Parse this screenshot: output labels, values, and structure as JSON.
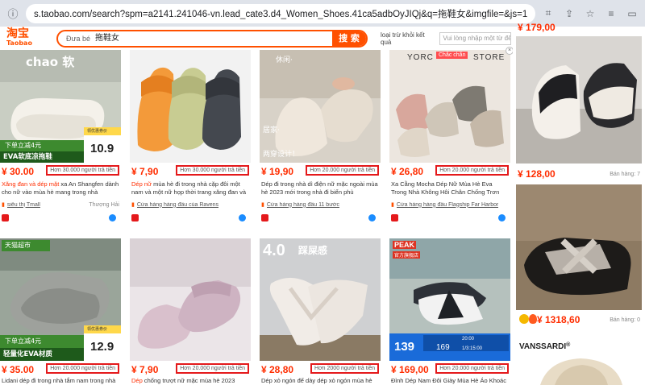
{
  "browser": {
    "url": "s.taobao.com/search?spm=a2141.241046-vn.lead_cate3.d4_Women_Shoes.41ca5adbOyJIQj&q=拖鞋女&imgfile=&js=1&stats_click=s..."
  },
  "header": {
    "logo_cn": "淘宝",
    "logo_en": "Taobao",
    "search_scope": "Đưa bé",
    "search_query": "拖鞋女",
    "search_button": "搜 索",
    "exclude_label": "loại trừ khỏi kết quả",
    "exclude_placeholder": "Vui lòng nhập một từ để"
  },
  "products": [
    {
      "img_tag": "chao 软",
      "badge_top": "下单立减4元",
      "badge_main": "EVA软底凉拖鞋",
      "badge_price_label": "领优惠券价",
      "badge_price": "10.9",
      "price": "¥ 30.00",
      "paid": "Hơn 30.000 người trả tiền",
      "title_hl": "Xăng đan và dép mặt",
      "title_rest": " xa An Shangfen dành cho nữ vào mùa hè mang trong nhà",
      "shop": "siêu thị Tmall",
      "location": "Thượng Hải"
    },
    {
      "price": "¥ 7,90",
      "paid": "Hơn 30.000 người trả tiền",
      "title_hl": "Dép nữ",
      "title_rest": " mùa hè đi trong nhà cặp đôi một nam và một nữ họp thời trang xăng đan và",
      "shop": "Cửa hàng hàng đầu của Ravens",
      "location": ""
    },
    {
      "img_tag": "休闲·",
      "img_tag2": "居家·",
      "img_tag3": "两穿设计！",
      "price": "¥ 19,90",
      "paid": "Hơn 20.000 người trả tiền",
      "title_hl": "",
      "title_rest": "Dép đi trong nhà dì điện nữ mặc ngoài mùa hè 2023 mới trong nhà đi biển phù",
      "shop": "Cửa hàng hàng đầu 11 bước",
      "location": ""
    },
    {
      "img_tag": "YORC",
      "img_tag2": "STORE",
      "img_badge": "Chắc chắn",
      "price": "¥ 26,80",
      "paid": "Hơn 20.000 người trả tiền",
      "title_hl": "",
      "title_rest": "Xa Cằng Mocha Dép Nữ Mùa Hè Eva Trong Nhà Không Hôi Chân Chống Trơn",
      "shop": "Cửa hàng hàng đầu Flagship Far Harbor",
      "location": ""
    },
    {
      "img_tag": "天猫超市",
      "badge_top": "下单立减4元",
      "badge_main": "轻量化EVA材质",
      "badge_price_label": "领优惠券价",
      "badge_price": "12.9",
      "price": "¥ 35.00",
      "paid": "Hơn 20.000 người trả tiền",
      "title_hl": "",
      "title_rest": "Lidani dép đi trong nhà tắm nam trong nhà",
      "shop": "",
      "location": ""
    },
    {
      "price": "¥ 7,90",
      "paid": "Hơn 20.000 người trả tiền",
      "title_hl": "Dép",
      "title_rest": " chống trượt nữ mặc mùa hè 2023",
      "shop": "",
      "location": ""
    },
    {
      "img_tag": "4.0",
      "img_tag2": "踩屎感",
      "price": "¥ 28,80",
      "paid": "Hơn 2000 người trả tiền",
      "title_hl": "",
      "title_rest": "Dép xỏ ngón đế dày dép xỏ ngón mùa hè",
      "shop": "",
      "location": ""
    },
    {
      "img_tag": "PEAK",
      "img_tag2": "官方旗舰店",
      "promo_price": "139",
      "promo_tags": [
        "169",
        "20:00",
        "1/3:15:00"
      ],
      "price": "¥ 169,00",
      "paid": "Hơn 20.000 người trả tiền",
      "title_hl": "",
      "title_rest": "Đỉnh Dép Nam Đôi Giày Mùa Hè Áo Khoác",
      "shop": "",
      "location": ""
    }
  ],
  "right_column": {
    "top_price": "¥ 179,00",
    "item1_price": "¥ 128,00",
    "item1_sold_label": "Bán hàng:",
    "item1_sold": "7",
    "item2_price": "¥ 1318,60",
    "item2_sold_label": "Bán hàng:",
    "item2_sold": "0",
    "brand": "VANSSARDI",
    "brand_mark": "®"
  },
  "colors": {
    "accent": "#ff5000",
    "price_red": "#ff2d00",
    "highlight_box": "#e4191b"
  }
}
